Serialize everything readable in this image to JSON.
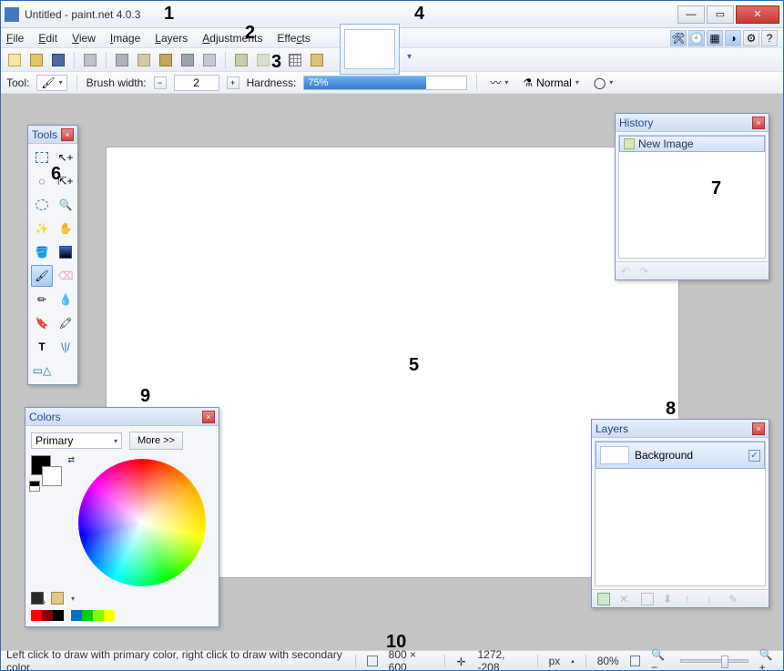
{
  "window": {
    "title": "Untitled - paint.net 4.0.3"
  },
  "menu": {
    "file": "File",
    "edit": "Edit",
    "view": "View",
    "image": "Image",
    "layers": "Layers",
    "adjustments": "Adjustments",
    "effects": "Effects"
  },
  "toolbar2": {
    "tool_label": "Tool:",
    "brush_label": "Brush width:",
    "brush_value": "2",
    "hardness_label": "Hardness:",
    "hardness_value": "75%",
    "blend_mode": "Normal"
  },
  "tools_panel": {
    "title": "Tools"
  },
  "history_panel": {
    "title": "History",
    "items": [
      {
        "label": "New Image"
      }
    ]
  },
  "layers_panel": {
    "title": "Layers",
    "rows": [
      {
        "name": "Background",
        "visible": true
      }
    ]
  },
  "colors_panel": {
    "title": "Colors",
    "which": "Primary",
    "more": "More >>",
    "swatches": [
      "#ff0000",
      "#800000",
      "#000000",
      "#0070c0",
      "#00d000",
      "#80ff00",
      "#ffff00"
    ]
  },
  "statusbar": {
    "hint": "Left click to draw with primary color, right click to draw with secondary color.",
    "size": "800 × 600",
    "cursor": "1272, -208",
    "units": "px",
    "zoom": "80%"
  },
  "overlay": {
    "n1": "1",
    "n2": "2",
    "n3": "3",
    "n4": "4",
    "n5": "5",
    "n6": "6",
    "n7": "7",
    "n8": "8",
    "n9": "9",
    "n10": "10"
  }
}
